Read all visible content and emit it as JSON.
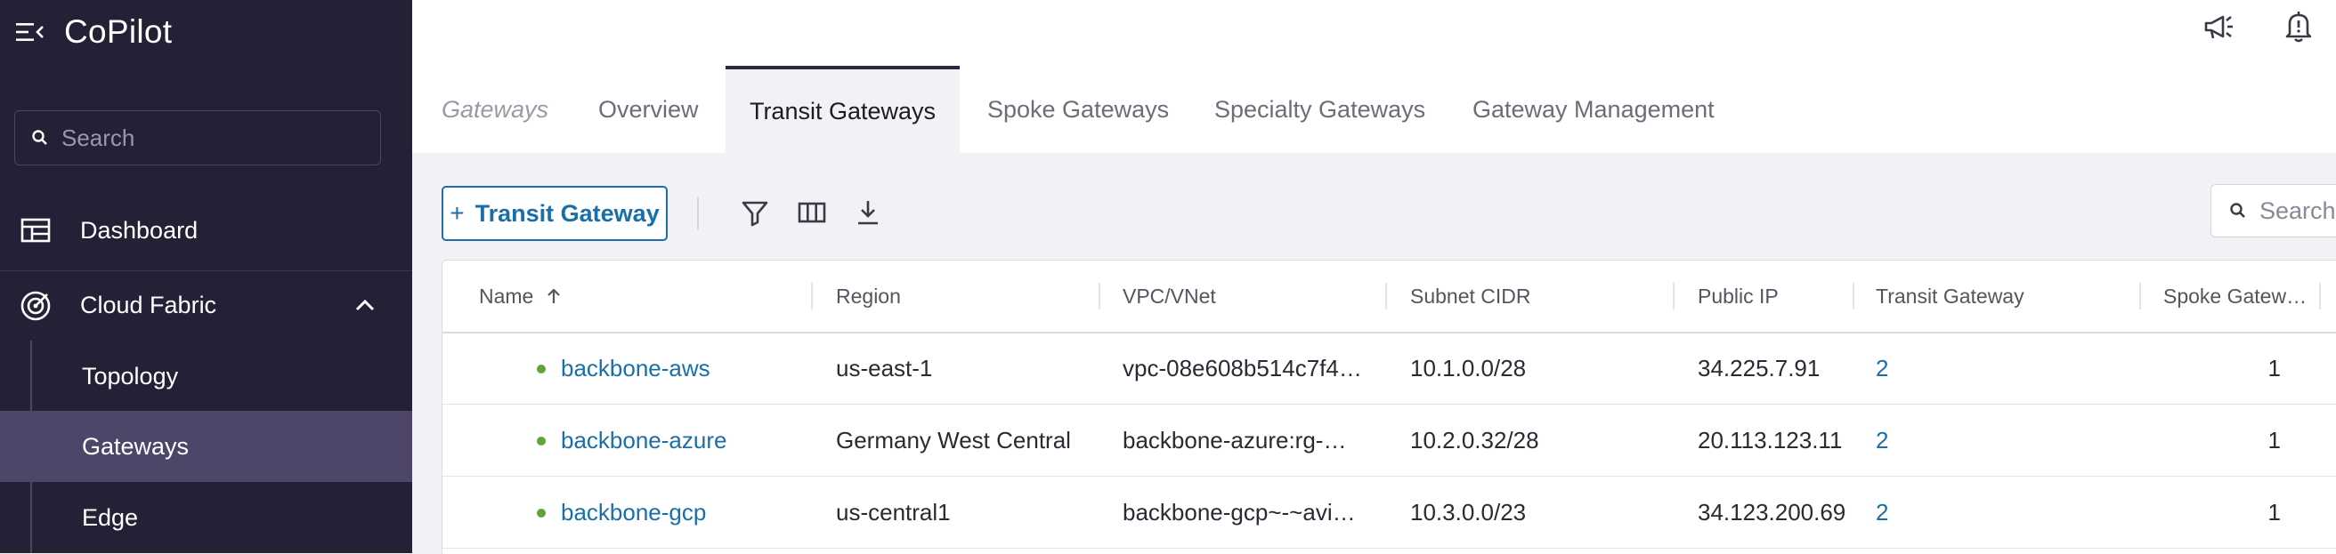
{
  "app": {
    "title": "CoPilot"
  },
  "sidebar": {
    "search_placeholder": "Search",
    "items": [
      {
        "label": "Dashboard"
      },
      {
        "label": "Cloud Fabric"
      }
    ],
    "sub_items": [
      {
        "label": "Topology"
      },
      {
        "label": "Gateways"
      },
      {
        "label": "Edge"
      }
    ]
  },
  "tabs": {
    "crumb": "Gateways",
    "items": [
      {
        "label": "Overview"
      },
      {
        "label": "Transit Gateways"
      },
      {
        "label": "Spoke Gateways"
      },
      {
        "label": "Specialty Gateways"
      },
      {
        "label": "Gateway Management"
      }
    ]
  },
  "toolbar": {
    "add_label": "Transit Gateway",
    "add_plus": "+",
    "search_placeholder": "Search"
  },
  "table": {
    "columns": [
      "Name",
      "Region",
      "VPC/VNet",
      "Subnet CIDR",
      "Public IP",
      "Transit Gateway",
      "Spoke Gatew…"
    ],
    "rows": [
      {
        "name": "backbone-aws",
        "region": "us-east-1",
        "vpc": "vpc-08e608b514c7f4…",
        "cidr": "10.1.0.0/28",
        "ip": "34.225.7.91",
        "transit": "2",
        "spoke": "1"
      },
      {
        "name": "backbone-azure",
        "region": "Germany West Central",
        "vpc": "backbone-azure:rg-…",
        "cidr": "10.2.0.32/28",
        "ip": "20.113.123.11",
        "transit": "2",
        "spoke": "1"
      },
      {
        "name": "backbone-gcp",
        "region": "us-central1",
        "vpc": "backbone-gcp~-~avi…",
        "cidr": "10.3.0.0/23",
        "ip": "34.123.200.69",
        "transit": "2",
        "spoke": "1"
      }
    ]
  },
  "colors": {
    "sidebar_bg": "#232136",
    "active_nav": "#4d4668",
    "accent": "#1a6fa8",
    "status_up": "#5fa33a"
  }
}
